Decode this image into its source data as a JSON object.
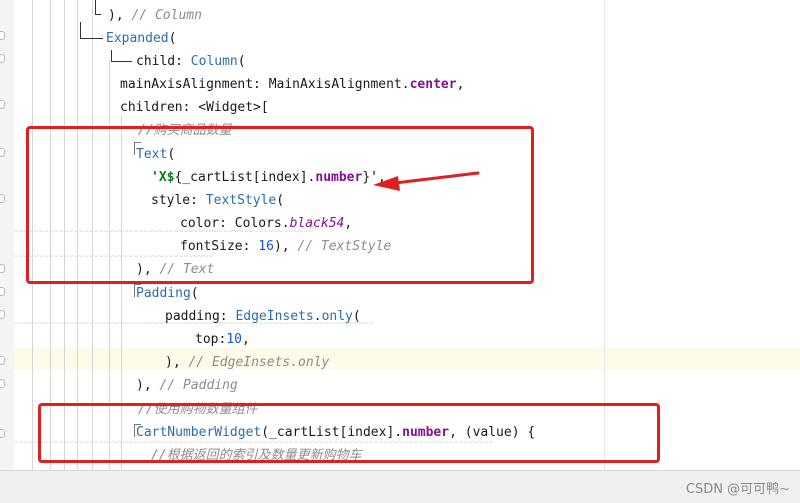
{
  "code_lines": {
    "l0": {
      "punc": "), ",
      "comment": "// Column"
    },
    "l1": {
      "name": "Expanded",
      "paren": "("
    },
    "l2": {
      "label": "child: ",
      "name": "Column",
      "paren": "("
    },
    "l3": {
      "key": "mainAxisAlignment: MainAxisAlignment.",
      "field": "center",
      "end": ","
    },
    "l4": {
      "text": "children: <Widget>["
    },
    "l5": {
      "comment": "//购买商品数量"
    },
    "l6": {
      "name": "Text",
      "paren": "("
    },
    "l7": {
      "q1": "'X$",
      "expr_a": "{_cartList[index].",
      "field": "number",
      "expr_b": "}",
      "q2": "'",
      "end": ","
    },
    "l8": {
      "label": "style: ",
      "name": "TextStyle",
      "paren": "("
    },
    "l9": {
      "key": "color: Colors.",
      "field": "black54",
      "end": ","
    },
    "l10": {
      "key": "fontSize: ",
      "num": "16",
      "end": "), ",
      "comment": "// TextStyle"
    },
    "l11": {
      "punc": "), ",
      "comment": "// Text"
    },
    "l12": {
      "name": "Padding",
      "paren": "("
    },
    "l13": {
      "label": "padding: ",
      "name": "EdgeInsets",
      "dot": ".",
      "method": "only",
      "paren": "("
    },
    "l14": {
      "key": "top:",
      "num": "10",
      "end": ","
    },
    "l15": {
      "punc": "), ",
      "comment": "// EdgeInsets.only"
    },
    "l16": {
      "punc": "), ",
      "comment": "// Padding"
    },
    "l17": {
      "comment": "//使用购物数量组件"
    },
    "l18": {
      "name": "CartNumberWidget",
      "args_a": "(_cartList[index].",
      "field": "number",
      "args_b": ", (value) {"
    },
    "l19": {
      "comment": "//根据返回的索引及数量更新购物车"
    }
  },
  "watermark": "CSDN @可可鸭~",
  "colors": {
    "highlight_box": "#e02020",
    "arrow": "#e02020",
    "current_line": "#fdfbe7"
  }
}
